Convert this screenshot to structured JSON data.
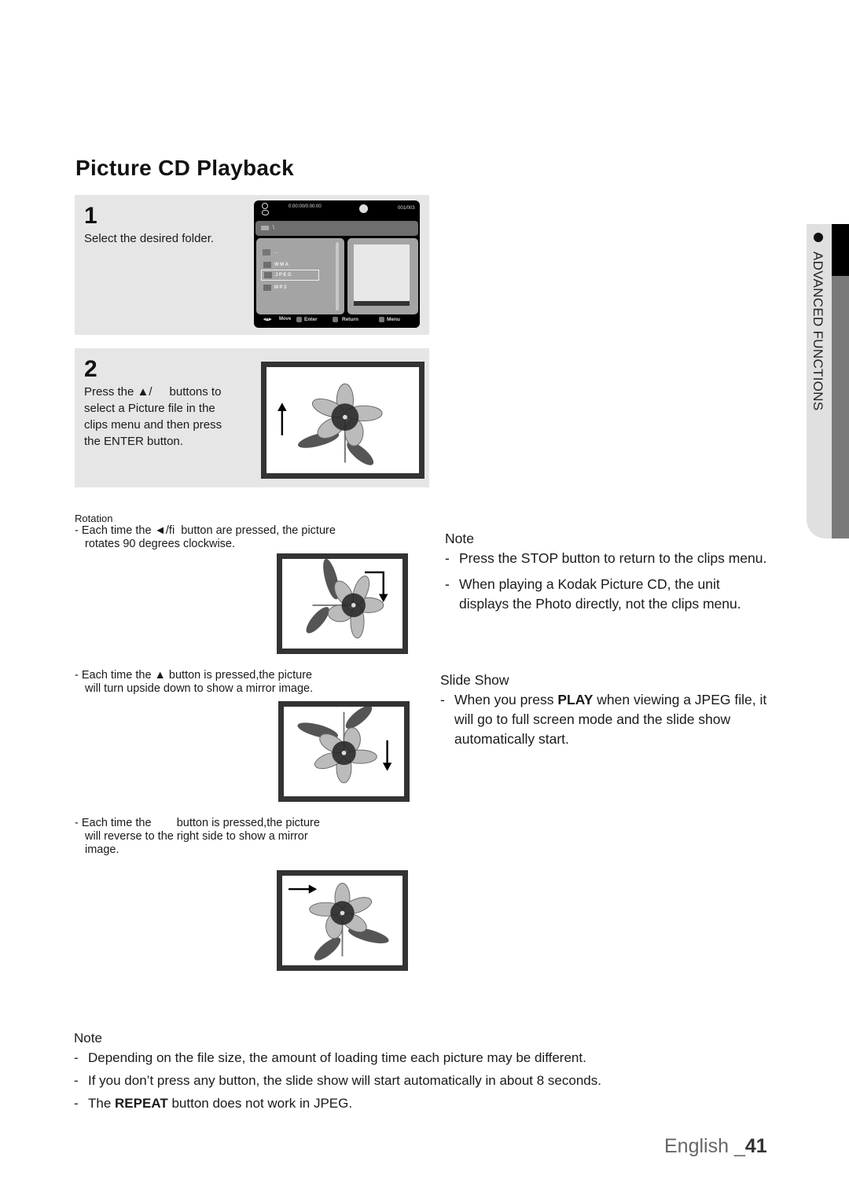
{
  "page": {
    "title": "Picture CD Playback",
    "side_tab": "ADVANCED FUNCTIONS",
    "footer_language": "English _",
    "footer_page": "41"
  },
  "step1": {
    "number": "1",
    "text": "Select the desired folder.",
    "osd": {
      "time": "0:00:00/0:00:00",
      "counter": "001/003",
      "path": "\\",
      "parent": "..",
      "folders": [
        "WMA",
        "JPEG",
        "MP3"
      ],
      "selected_folder": "JPEG",
      "footer": {
        "move": "Move",
        "enter": "Enter",
        "return": "Return",
        "menu": "Menu"
      }
    }
  },
  "step2": {
    "number": "2",
    "line1_a": "Press the ▲/",
    "line1_b": "buttons to",
    "line2": "select a Picture file in the",
    "line3": "clips menu and then press",
    "line4_a": "the",
    "line4_b": "ENTER",
    "line4_c": "button."
  },
  "rotation": {
    "heading": "Rotation",
    "item1_line1": "- Each time the ◄/fi  button are pressed, the picture",
    "item1_line2": "rotates 90 degrees clockwise.",
    "item2_line1": "- Each time the ▲ button is pressed,the picture",
    "item2_line2": "will turn upside down to show a mirror image.",
    "item3_line1": "- Each time the        button is pressed,the picture",
    "item3_line2": "will reverse to the right side to show a mirror",
    "item3_line3": "image."
  },
  "note_right": {
    "heading": "Note",
    "items": [
      "Press the STOP button to return to the clips menu.",
      "When playing a Kodak Picture CD, the unit displays the Photo directly, not the clips menu."
    ]
  },
  "slide_show": {
    "heading": "Slide Show",
    "text_a": "When you press",
    "text_bold": "PLAY",
    "text_b": "when viewing a JPEG file, it will go to full screen mode and the slide show automatically start."
  },
  "note_bottom": {
    "heading": "Note",
    "items": [
      "Depending on the file size, the amount of loading time each picture may be different.",
      "If you don’t press any button, the slide show will start automatically in about 8 seconds."
    ],
    "item3_a": "The",
    "item3_bold": "REPEAT",
    "item3_b": "button does not work in JPEG."
  },
  "colors": {
    "step_box": "#e6e6e6",
    "osd_background": "#000000",
    "frame_border": "#333333",
    "side_tab_accent": "#7a7a7a"
  }
}
